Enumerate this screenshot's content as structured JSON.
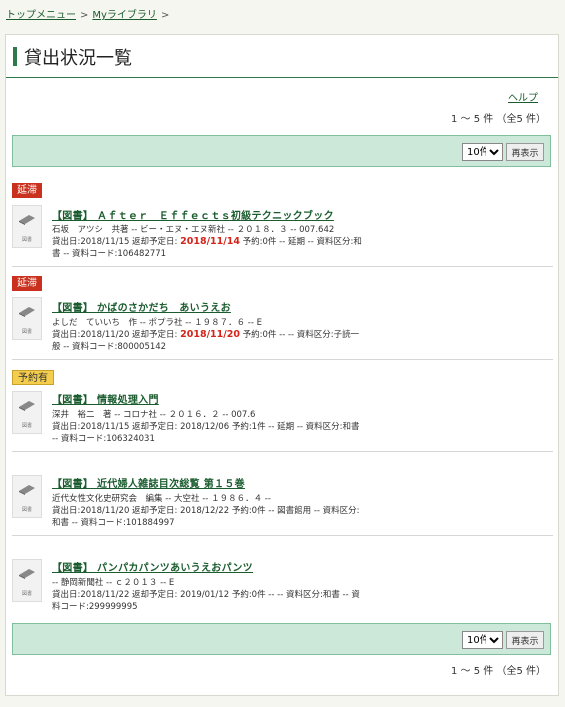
{
  "breadcrumb": {
    "top_menu": "トップメニュー",
    "my_library": "Myライブラリ",
    "separator": ">"
  },
  "page": {
    "title": "貸出状況一覧",
    "help": "ヘルプ",
    "count_top": "1 ～ 5 件 （全5 件）",
    "count_bottom": "1 ～ 5 件 （全5 件）"
  },
  "controls": {
    "per_page_selected": "10件",
    "redisplay_label": "再表示"
  },
  "thumb_label": "図書",
  "items": [
    {
      "badge": "延滞",
      "badge_type": "overdue",
      "title": "【図書】 Ａｆｔｅｒ　Ｅｆｆｅｃｔｓ初級テクニックブック",
      "meta": "石坂　アツシ　共著 -- ビー・エヌ・エヌ新社 -- ２０１８．３ -- 007.642",
      "desc_before": "貸出日:2018/11/15  返却予定日: ",
      "due": "2018/11/14",
      "desc_after": " 予約:0件 -- 延期 -- 資料区分:和書 -- 資料コード:106482771"
    },
    {
      "badge": "延滞",
      "badge_type": "overdue",
      "title": "【図書】 かばのさかだち　あいうえお",
      "meta": "よしだ　ていいち　作 -- ポプラ社 -- １９８７．６ -- E",
      "desc_before": "貸出日:2018/11/20  返却予定日: ",
      "due": "2018/11/20",
      "desc_after": " 予約:0件 -- -- 資料区分:子読一般 -- 資料コード:800005142"
    },
    {
      "badge": "予約有",
      "badge_type": "reserved",
      "title": "【図書】 情報処理入門",
      "meta": "深井　裕二　著 -- コロナ社 -- ２０１６．２ -- 007.6",
      "desc_before": "貸出日:2018/11/15  返却予定日: 2018/12/06 予約:1件 -- 延期 -- 資料区分:和書 -- 資料コード:106324031",
      "due": "",
      "desc_after": ""
    },
    {
      "badge": "",
      "badge_type": "",
      "title": "【図書】 近代婦人雑誌目次総覧 第１５巻",
      "meta": "近代女性文化史研究会　編集 -- 大空社 -- １９８６．４ --",
      "desc_before": "貸出日:2018/11/20  返却予定日: 2018/12/22 予約:0件 -- 図書館用 -- 資料区分:和書 -- 資料コード:101884997",
      "due": "",
      "desc_after": ""
    },
    {
      "badge": "",
      "badge_type": "",
      "title": "【図書】 パンパカパンツあいうえおパンツ",
      "meta": "-- 静岡新聞社 -- ｃ２０１３ -- E",
      "desc_before": "貸出日:2018/11/22  返却予定日: 2019/01/12 予約:0件 -- -- 資料区分:和書 -- 資料コード:299999995",
      "due": "",
      "desc_after": ""
    }
  ],
  "colors": {
    "accent_green": "#2f7a4a",
    "control_bar_bg": "#cce8d9",
    "overdue_red": "#c9301d",
    "reserved_yellow": "#f4cd4e",
    "due_date_red": "#d4241b"
  },
  "icons": {
    "thumbnail": "book-icon"
  }
}
